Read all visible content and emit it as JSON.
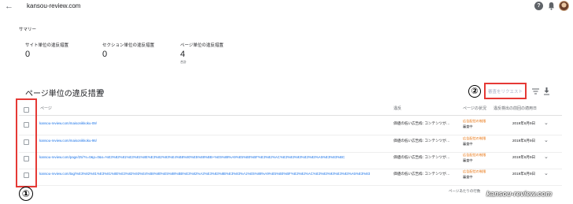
{
  "header": {
    "site": "kansou-review.com"
  },
  "summary": {
    "label": "サマリー",
    "cards": [
      {
        "label": "サイト単位の違反措置",
        "value": "0",
        "sub": ""
      },
      {
        "label": "セクション単位の違反措置",
        "value": "0",
        "sub": ""
      },
      {
        "label": "ページ単位の違反措置",
        "value": "4",
        "sub": "合計"
      }
    ]
  },
  "section": {
    "title": "ページ単位の違反措置",
    "review_button": "審査をリクエスト",
    "marker_right": "②",
    "marker_left": "①"
  },
  "table": {
    "headers": {
      "page": "ページ",
      "issue": "違反",
      "status": "ページの状況",
      "date": "違反検出の前回の適用日"
    },
    "rows": [
      {
        "url": "kansou-review.com/maisonikkoku-09/",
        "issue": "価値の低い広告枠: コンテンツが…",
        "status": "広告配信の制限",
        "status2": "審査中",
        "date": "2019年6月9日"
      },
      {
        "url": "kansou-review.com/maisonikkoku-96/",
        "issue": "価値の低い広告枠: コンテンツが…",
        "status": "広告配信の制限",
        "status2": "審査中",
        "date": "2019年6月9日"
      },
      {
        "url": "kansou-review.com/page/25/?s=0&p=0&s=%E3%82%81%E3%81%8E%E3%82%93%E4%B8%80%E5%88%BB+%E5%88%A9%E5%B0%BF%E3%82%AC%E3%83%93%E3%83%A5%E3%83%BC",
        "issue": "価値の低い広告枠: コンテンツが…",
        "status": "広告配信の制限",
        "status2": "審査中",
        "date": "2019年6月9日"
      },
      {
        "url": "kansou-review.com/tag/%E3%82%81%E3%81%8E%E3%82%93%E4%B8%80%E5%88%BB%E3%82%A2%E3%83%8B%E3%83%A1%E5%88%A9%E5%B0%BF%E3%82%AC%E3%83%93%E3%83%A5%E3%83%BC…",
        "issue": "価値の低い広告枠: コンテンツが…",
        "status": "広告配信の制限",
        "status2": "審査中",
        "date": "2019年6月9日"
      }
    ]
  },
  "footer": {
    "rows_per_page": "ページあたりの行数"
  },
  "watermark": "kansou-review.com",
  "colors": {
    "link": "#1a73e8",
    "status_warning": "#e8710a",
    "annotation": "#e53935"
  },
  "icons": [
    "back-arrow-icon",
    "help-icon",
    "bell-icon",
    "info-icon",
    "filter-icon",
    "download-icon",
    "chevron-down-icon",
    "checkbox-icon"
  ]
}
